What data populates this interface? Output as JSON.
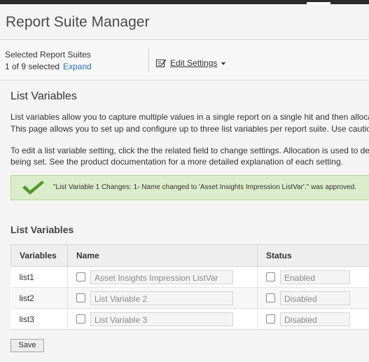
{
  "header": {
    "title": "Report Suite Manager"
  },
  "selection": {
    "label": "Selected Report Suites",
    "count_text": "1 of 9 selected",
    "expand_label": "Expand"
  },
  "toolbar": {
    "edit_settings_label": "Edit Settings"
  },
  "section": {
    "title": "List Variables",
    "desc_line1": "List variables allow you to capture multiple values in a single report on a single hit and then alloca",
    "desc_line2": "This page allows you to set up and configure up to three list variables per report suite. Use caution",
    "desc_line3": "To edit a list variable setting, click the the related field to change settings. Allocation is used to dete",
    "desc_line4": "being set. See the product documentation for a more detailed explanation of each setting."
  },
  "success_message": "\"List Variable 1 Changes: 1- Name changed to 'Asset Insights Impression ListVar'.\" was approved.",
  "table": {
    "title": "List Variables",
    "columns": [
      "Variables",
      "Name",
      "Status"
    ],
    "rows": [
      {
        "variable": "list1",
        "name": "Asset Insights Impression ListVar",
        "status": "Enabled"
      },
      {
        "variable": "list2",
        "name": "List Variable 2",
        "status": "Disabled"
      },
      {
        "variable": "list3",
        "name": "List Variable 3",
        "status": "Disabled"
      }
    ]
  },
  "actions": {
    "save_label": "Save"
  },
  "colors": {
    "link": "#2d6fb5",
    "success_bg": "#dbeccb",
    "success_check": "#4e9a2a",
    "topbar": "#2b2b2b"
  },
  "icons": {
    "edit_settings": "edit-document-icon",
    "success": "checkmark-icon"
  }
}
